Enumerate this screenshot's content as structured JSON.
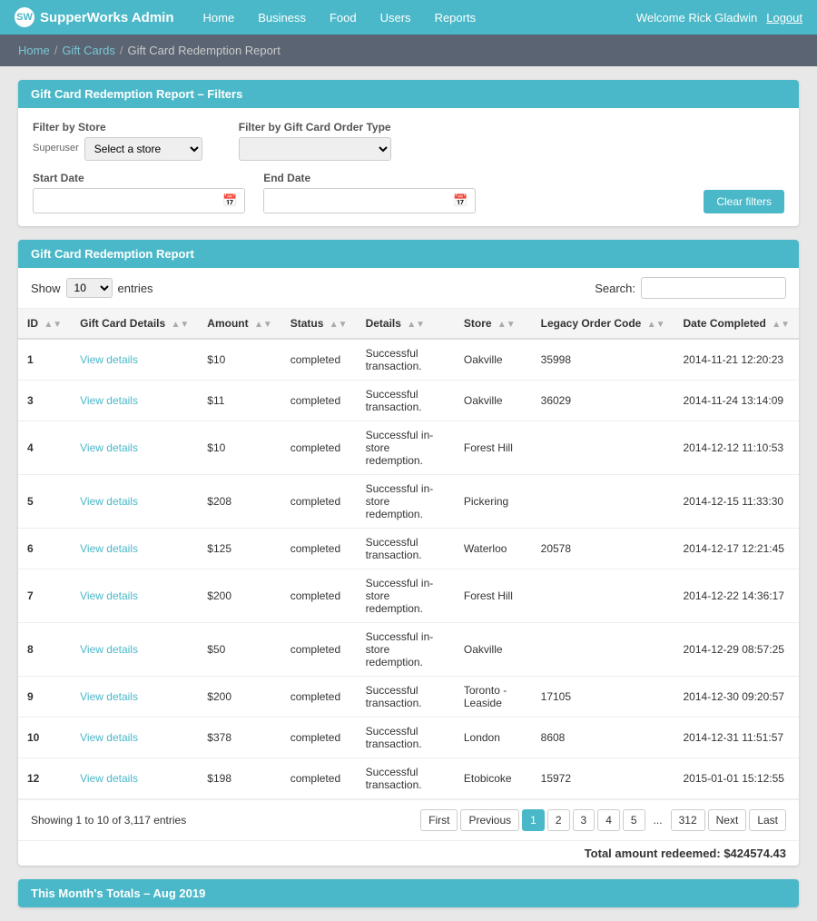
{
  "app": {
    "brand": "SupperWorks Admin",
    "welcome": "Welcome Rick Gladwin",
    "logout_label": "Logout"
  },
  "nav": {
    "links": [
      "Home",
      "Business",
      "Food",
      "Users",
      "Reports"
    ]
  },
  "breadcrumb": {
    "home": "Home",
    "gift_cards": "Gift Cards",
    "current": "Gift Card Redemption Report"
  },
  "filter_section": {
    "header": "Gift Card Redemption Report – Filters",
    "store_label": "Filter by Store",
    "store_sublabel": "Superuser",
    "store_placeholder": "Select a store",
    "order_type_label": "Filter by Gift Card Order Type",
    "start_date_label": "Start Date",
    "end_date_label": "End Date",
    "clear_button": "Clear filters"
  },
  "report_section": {
    "header": "Gift Card Redemption Report",
    "show_label": "Show",
    "entries_label": "entries",
    "show_value": "10",
    "search_label": "Search:",
    "columns": [
      "ID",
      "Gift Card Details",
      "Amount",
      "Status",
      "Details",
      "Store",
      "Legacy Order Code",
      "Date Completed"
    ],
    "rows": [
      {
        "id": "1",
        "gift_card": "View details",
        "amount": "$10",
        "status": "completed",
        "details": "Successful transaction.",
        "store": "Oakville",
        "legacy_order": "35998",
        "date": "2014-11-21 12:20:23"
      },
      {
        "id": "3",
        "gift_card": "View details",
        "amount": "$11",
        "status": "completed",
        "details": "Successful transaction.",
        "store": "Oakville",
        "legacy_order": "36029",
        "date": "2014-11-24 13:14:09"
      },
      {
        "id": "4",
        "gift_card": "View details",
        "amount": "$10",
        "status": "completed",
        "details": "Successful in-store redemption.",
        "store": "Forest Hill",
        "legacy_order": "",
        "date": "2014-12-12 11:10:53"
      },
      {
        "id": "5",
        "gift_card": "View details",
        "amount": "$208",
        "status": "completed",
        "details": "Successful in-store redemption.",
        "store": "Pickering",
        "legacy_order": "",
        "date": "2014-12-15 11:33:30"
      },
      {
        "id": "6",
        "gift_card": "View details",
        "amount": "$125",
        "status": "completed",
        "details": "Successful transaction.",
        "store": "Waterloo",
        "legacy_order": "20578",
        "date": "2014-12-17 12:21:45"
      },
      {
        "id": "7",
        "gift_card": "View details",
        "amount": "$200",
        "status": "completed",
        "details": "Successful in-store redemption.",
        "store": "Forest Hill",
        "legacy_order": "",
        "date": "2014-12-22 14:36:17"
      },
      {
        "id": "8",
        "gift_card": "View details",
        "amount": "$50",
        "status": "completed",
        "details": "Successful in-store redemption.",
        "store": "Oakville",
        "legacy_order": "",
        "date": "2014-12-29 08:57:25"
      },
      {
        "id": "9",
        "gift_card": "View details",
        "amount": "$200",
        "status": "completed",
        "details": "Successful transaction.",
        "store": "Toronto - Leaside",
        "legacy_order": "17105",
        "date": "2014-12-30 09:20:57"
      },
      {
        "id": "10",
        "gift_card": "View details",
        "amount": "$378",
        "status": "completed",
        "details": "Successful transaction.",
        "store": "London",
        "legacy_order": "8608",
        "date": "2014-12-31 11:51:57"
      },
      {
        "id": "12",
        "gift_card": "View details",
        "amount": "$198",
        "status": "completed",
        "details": "Successful transaction.",
        "store": "Etobicoke",
        "legacy_order": "15972",
        "date": "2015-01-01 15:12:55"
      }
    ],
    "showing_text": "Showing 1 to 10 of 3,117 entries",
    "pagination": {
      "first": "First",
      "previous": "Previous",
      "pages": [
        "1",
        "2",
        "3",
        "4",
        "5"
      ],
      "ellipsis": "...",
      "total_pages": "312",
      "next": "Next",
      "last": "Last"
    },
    "total_amount": "Total amount redeemed: $424574.43"
  },
  "month_section": {
    "header": "This Month's Totals – Aug 2019"
  }
}
